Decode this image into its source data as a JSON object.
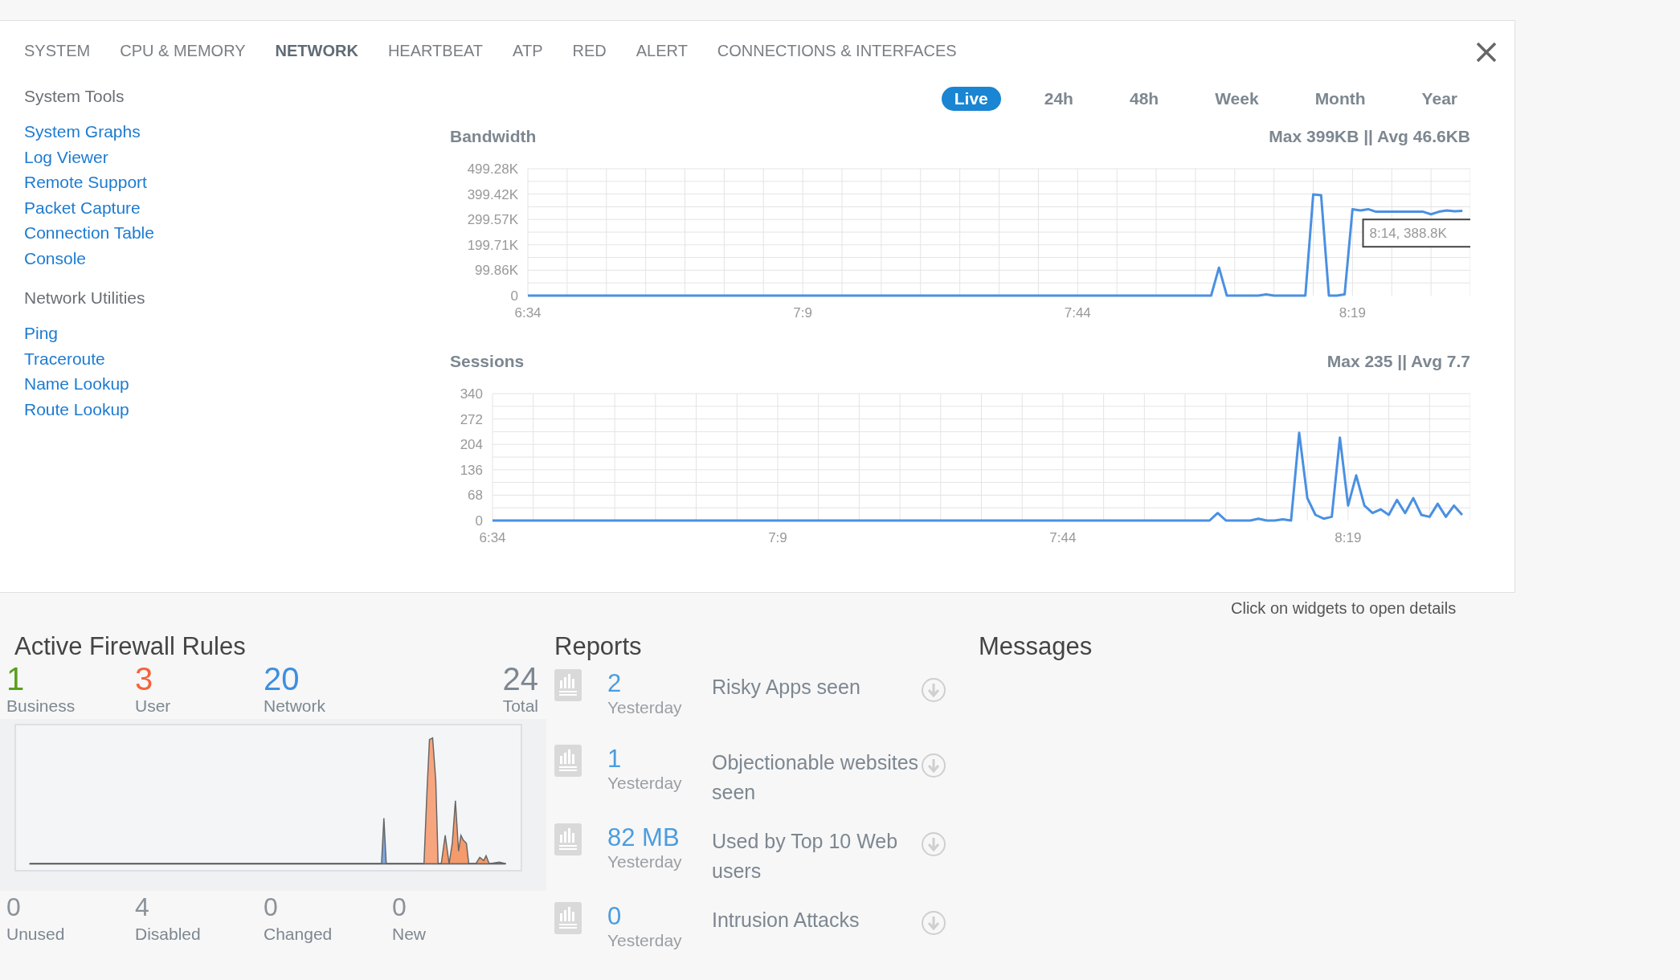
{
  "tabs": [
    {
      "label": "SYSTEM",
      "selected": false
    },
    {
      "label": "CPU & MEMORY",
      "selected": false
    },
    {
      "label": "NETWORK",
      "selected": true
    },
    {
      "label": "HEARTBEAT",
      "selected": false
    },
    {
      "label": "ATP",
      "selected": false
    },
    {
      "label": "RED",
      "selected": false
    },
    {
      "label": "ALERT",
      "selected": false
    },
    {
      "label": "CONNECTIONS & INTERFACES",
      "selected": false
    }
  ],
  "sidebar": [
    {
      "heading": "System Tools",
      "links": [
        "System Graphs",
        "Log Viewer",
        "Remote Support",
        "Packet Capture",
        "Connection Table",
        "Console"
      ]
    },
    {
      "heading": "Network Utilities",
      "links": [
        "Ping",
        "Traceroute",
        "Name Lookup",
        "Route Lookup"
      ]
    }
  ],
  "ranges": [
    {
      "label": "Live",
      "selected": true
    },
    {
      "label": "24h",
      "selected": false
    },
    {
      "label": "48h",
      "selected": false
    },
    {
      "label": "Week",
      "selected": false
    },
    {
      "label": "Month",
      "selected": false
    },
    {
      "label": "Year",
      "selected": false
    }
  ],
  "charts": [
    {
      "summary": "Max 399KB || Avg 46.6KB",
      "tooltip": "8:14, 388.8K",
      "chart_data": {
        "type": "line",
        "grid": true,
        "title": "Bandwidth",
        "categories": [
          "6:34",
          null,
          null,
          null,
          null,
          null,
          null,
          null,
          null,
          null,
          null,
          null,
          null,
          null,
          null,
          null,
          null,
          null,
          null,
          null,
          null,
          null,
          null,
          null,
          null,
          null,
          null,
          null,
          null,
          null,
          null,
          null,
          null,
          null,
          null,
          "7:9",
          null,
          null,
          null,
          null,
          null,
          null,
          null,
          null,
          null,
          null,
          null,
          null,
          null,
          null,
          null,
          null,
          null,
          null,
          null,
          null,
          null,
          null,
          null,
          null,
          null,
          null,
          null,
          null,
          null,
          null,
          null,
          null,
          null,
          null,
          "7:44",
          null,
          null,
          null,
          null,
          null,
          null,
          null,
          null,
          null,
          null,
          null,
          null,
          null,
          null,
          null,
          null,
          null,
          null,
          null,
          null,
          null,
          null,
          null,
          null,
          null,
          null,
          null,
          null,
          null,
          null,
          null,
          null,
          null,
          null,
          "8:19",
          null,
          null,
          null,
          null,
          null,
          null,
          null,
          null,
          null,
          null,
          null,
          null,
          null,
          null
        ],
        "series": [
          {
            "color": "#4a90e2",
            "values": [
              0,
              0,
              0,
              0,
              0,
              0,
              0,
              0,
              0,
              0,
              0,
              0,
              0,
              0,
              0,
              0,
              0,
              0,
              0,
              0,
              0,
              0,
              0,
              0,
              0,
              0,
              0,
              0,
              0,
              0,
              0,
              0,
              0,
              0,
              0,
              0,
              0,
              0,
              0,
              0,
              0,
              0,
              0,
              0,
              0,
              0,
              0,
              0,
              0,
              0,
              0,
              0,
              0,
              0,
              0,
              0,
              0,
              0,
              0,
              0,
              0,
              0,
              0,
              0,
              0,
              0,
              0,
              0,
              0,
              0,
              0,
              0,
              0,
              0,
              0,
              0,
              0,
              0,
              0,
              0,
              0,
              0,
              0,
              0,
              0,
              0,
              0,
              0,
              110,
              0,
              0,
              0,
              0,
              0,
              5,
              0,
              0,
              0,
              0,
              0,
              398,
              395,
              0,
              0,
              5,
              340,
              335,
              340,
              330,
              330,
              330,
              330,
              330,
              330,
              330,
              320,
              330,
              335,
              332,
              333
            ]
          }
        ],
        "ylim": [
          0,
          499.28
        ],
        "yticks": [
          {
            "value": 0,
            "label": "0"
          },
          {
            "value": 99.86,
            "label": "99.86K"
          },
          {
            "value": 199.71,
            "label": "199.71K"
          },
          {
            "value": 299.57,
            "label": "299.57K"
          },
          {
            "value": 399.42,
            "label": "399.42K"
          },
          {
            "value": 499.28,
            "label": "499.28K"
          }
        ]
      }
    },
    {
      "summary": "Max 235 || Avg 7.7",
      "chart_data": {
        "type": "line",
        "grid": true,
        "title": "Sessions",
        "categories": [
          "6:34",
          null,
          null,
          null,
          null,
          null,
          null,
          null,
          null,
          null,
          null,
          null,
          null,
          null,
          null,
          null,
          null,
          null,
          null,
          null,
          null,
          null,
          null,
          null,
          null,
          null,
          null,
          null,
          null,
          null,
          null,
          null,
          null,
          null,
          null,
          "7:9",
          null,
          null,
          null,
          null,
          null,
          null,
          null,
          null,
          null,
          null,
          null,
          null,
          null,
          null,
          null,
          null,
          null,
          null,
          null,
          null,
          null,
          null,
          null,
          null,
          null,
          null,
          null,
          null,
          null,
          null,
          null,
          null,
          null,
          null,
          "7:44",
          null,
          null,
          null,
          null,
          null,
          null,
          null,
          null,
          null,
          null,
          null,
          null,
          null,
          null,
          null,
          null,
          null,
          null,
          null,
          null,
          null,
          null,
          null,
          null,
          null,
          null,
          null,
          null,
          null,
          null,
          null,
          null,
          null,
          null,
          "8:19",
          null,
          null,
          null,
          null,
          null,
          null,
          null,
          null,
          null,
          null,
          null,
          null,
          null,
          null
        ],
        "series": [
          {
            "color": "#4a90e2",
            "values": [
              0,
              0,
              0,
              0,
              0,
              0,
              0,
              0,
              0,
              0,
              0,
              0,
              0,
              0,
              0,
              0,
              0,
              0,
              0,
              0,
              0,
              0,
              0,
              0,
              0,
              0,
              0,
              0,
              0,
              0,
              0,
              0,
              0,
              0,
              0,
              0,
              0,
              0,
              0,
              0,
              0,
              0,
              0,
              0,
              0,
              0,
              0,
              0,
              0,
              0,
              0,
              0,
              0,
              0,
              0,
              0,
              0,
              0,
              0,
              0,
              0,
              0,
              0,
              0,
              0,
              0,
              0,
              0,
              0,
              0,
              0,
              0,
              0,
              0,
              0,
              0,
              0,
              0,
              0,
              0,
              0,
              0,
              0,
              0,
              0,
              0,
              0,
              0,
              0,
              20,
              0,
              0,
              0,
              0,
              5,
              0,
              0,
              3,
              0,
              235,
              60,
              15,
              5,
              10,
              222,
              40,
              121,
              40,
              20,
              30,
              15,
              55,
              20,
              60,
              15,
              10,
              45,
              10,
              40,
              15
            ]
          }
        ],
        "ylim": [
          0,
          340
        ],
        "yticks": [
          0,
          68,
          136,
          204,
          272,
          340
        ]
      }
    }
  ],
  "hint": "Click on widgets to open details",
  "firewall": {
    "title": "Active Firewall Rules",
    "top_stats": [
      {
        "value": "1",
        "label": "Business",
        "color": "#5a9e1e"
      },
      {
        "value": "3",
        "label": "User",
        "color": "#f5633a"
      },
      {
        "value": "20",
        "label": "Network",
        "color": "#3d8fe0"
      },
      {
        "value": "24",
        "label": "Total",
        "color": "#7d8791"
      }
    ],
    "bottom_stats": [
      {
        "value": "0",
        "label": "Unused"
      },
      {
        "value": "4",
        "label": "Disabled"
      },
      {
        "value": "0",
        "label": "Changed"
      },
      {
        "value": "0",
        "label": "New"
      }
    ]
  },
  "reports": {
    "title": "Reports",
    "items": [
      {
        "value": "2",
        "period": "Yesterday",
        "description": "Risky Apps seen"
      },
      {
        "value": "1",
        "period": "Yesterday",
        "description": "Objectionable websites seen"
      },
      {
        "value": "82 MB",
        "period": "Yesterday",
        "description": "Used by Top 10 Web users"
      },
      {
        "value": "0",
        "period": "Yesterday",
        "description": "Intrusion Attacks"
      }
    ]
  },
  "messages": {
    "title": "Messages"
  }
}
